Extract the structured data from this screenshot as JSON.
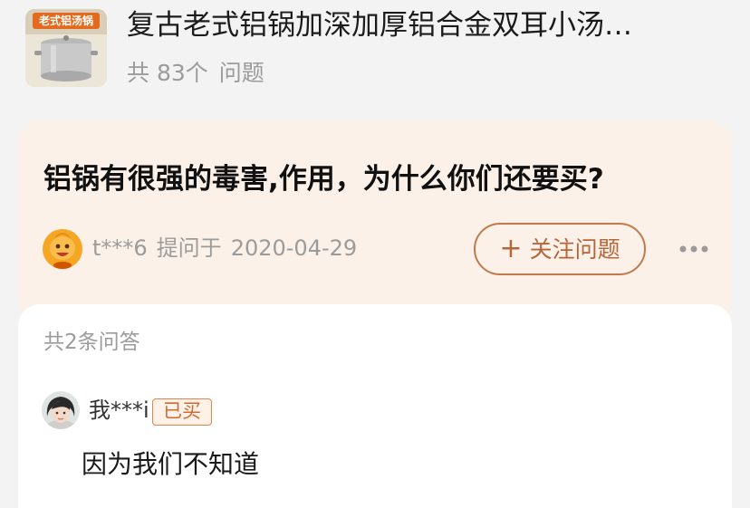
{
  "product": {
    "thumbnail_label": "老式铝汤锅",
    "title": "复古老式铝锅加深加厚铝合金双耳小汤…",
    "question_count_prefix": "共 83个",
    "question_count_suffix": "问题"
  },
  "question": {
    "title": "铝锅有很强的毒害,作用，为什么你们还要买?",
    "asker": "t***6",
    "asked_label": "提问于",
    "asked_date": "2020-04-29",
    "follow_label": "关注问题",
    "follow_icon": "plus-icon",
    "more_icon": "more-dots-icon"
  },
  "answers": {
    "count_label": "共2条问答",
    "items": [
      {
        "user": "我***i",
        "badge": "已买",
        "text": "因为我们不知道"
      }
    ]
  },
  "colors": {
    "accent": "#b4673a",
    "badge_border": "#e0834d",
    "question_card_bg": "#fcf1e8",
    "page_bg": "#f3f3f3",
    "muted_text": "#9b9b9b"
  }
}
